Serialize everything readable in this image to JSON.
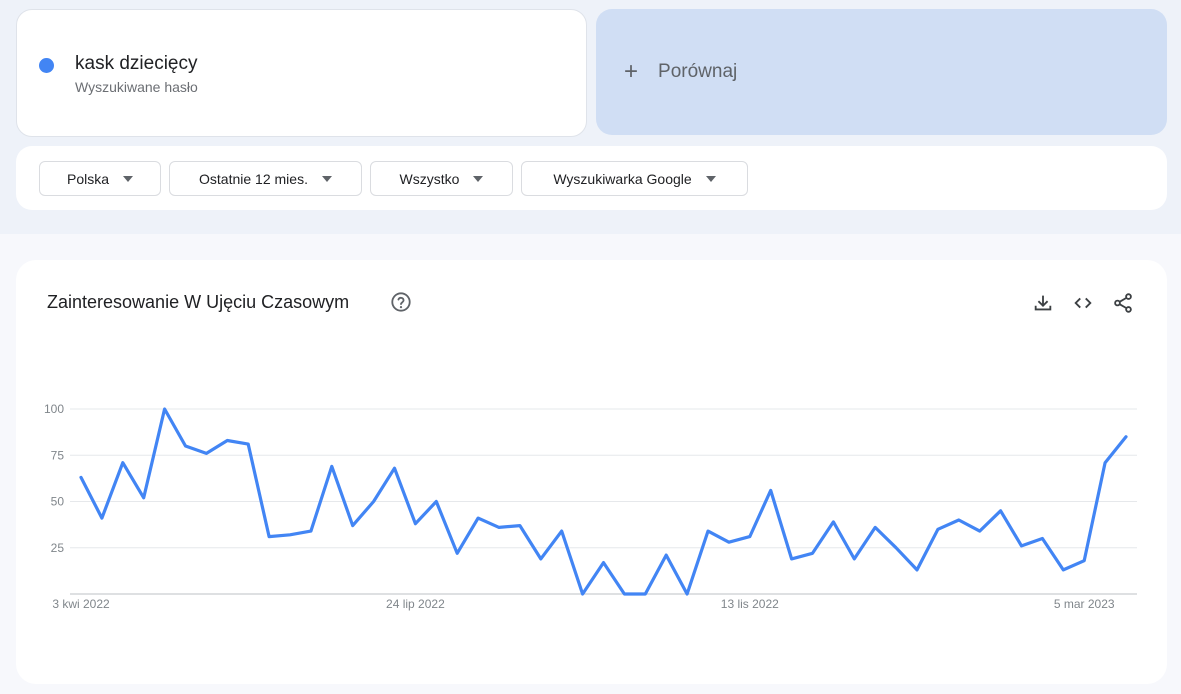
{
  "term": {
    "name": "kask dziecięcy",
    "subtitle": "Wyszukiwane hasło",
    "color": "#4285f4"
  },
  "compare": {
    "label": "Porównaj"
  },
  "filters": [
    {
      "label": "Polska"
    },
    {
      "label": "Ostatnie 12 mies."
    },
    {
      "label": "Wszystko"
    },
    {
      "label": "Wyszukiwarka Google"
    }
  ],
  "panel": {
    "title": "Zainteresowanie W Ujęciu Czasowym",
    "icons": [
      "help-icon",
      "download-icon",
      "embed-icon",
      "share-icon"
    ]
  },
  "chart_data": {
    "type": "line",
    "series": [
      {
        "values": [
          63,
          41,
          71,
          52,
          100,
          80,
          76,
          83,
          81,
          31,
          32,
          34,
          69,
          37,
          50,
          68,
          38,
          50,
          22,
          41,
          36,
          37,
          19,
          34,
          0,
          17,
          0,
          0,
          21,
          0,
          34,
          28,
          31,
          56,
          19,
          22,
          39,
          19,
          36,
          25,
          13,
          35,
          40,
          34,
          45,
          26,
          30,
          13,
          18,
          71,
          85
        ]
      }
    ],
    "y_ticks": [
      "25",
      "50",
      "75",
      "100"
    ],
    "x_ticks": [
      "3 kwi 2022",
      "24 lip 2022",
      "13 lis 2022",
      "5 mar 2023"
    ],
    "x_tick_index": [
      0,
      16,
      32,
      48
    ],
    "ylim": [
      0,
      100
    ],
    "grid": true,
    "color": "#4285f4"
  }
}
